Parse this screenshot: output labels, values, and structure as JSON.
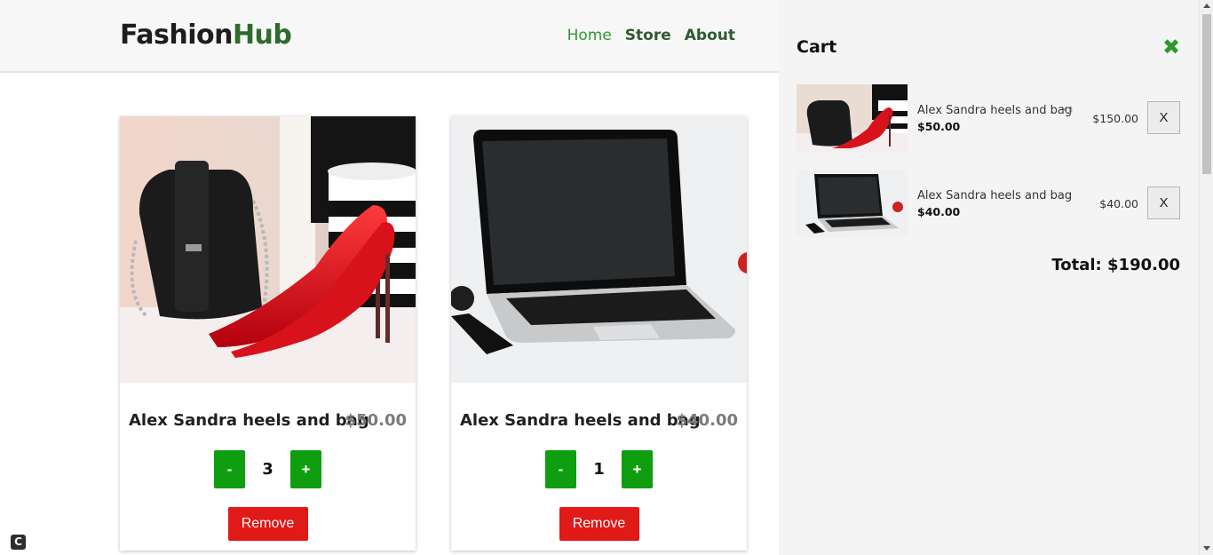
{
  "header": {
    "logo_part1": "Fashion",
    "logo_part2": "Hub",
    "nav": [
      {
        "label": "Home"
      },
      {
        "label": "Store"
      },
      {
        "label": "About"
      }
    ]
  },
  "products": [
    {
      "title": "Alex Sandra heels and bag",
      "price": "$50.00",
      "qty_minus": "-",
      "qty": "3",
      "qty_plus": "+",
      "remove_label": "Remove"
    },
    {
      "title": "Alex Sandra heels and bag",
      "price": "$40.00",
      "qty_minus": "-",
      "qty": "1",
      "qty_plus": "+",
      "remove_label": "Remove"
    }
  ],
  "cart": {
    "title": "Cart",
    "close_icon": "close-icon",
    "items": [
      {
        "name": "Alex Sandra heels and bag",
        "qty_badge": "X3",
        "unit_price": "$50.00",
        "subtotal": "$150.00",
        "remove_label": "X"
      },
      {
        "name": "Alex Sandra heels and bag",
        "qty_badge": "",
        "unit_price": "$40.00",
        "subtotal": "$40.00",
        "remove_label": "X"
      }
    ],
    "total": "Total: $190.00"
  },
  "colors": {
    "accent_green": "#0f9e0f",
    "brand_green": "#2e6b2e",
    "danger_red": "#e01919"
  }
}
